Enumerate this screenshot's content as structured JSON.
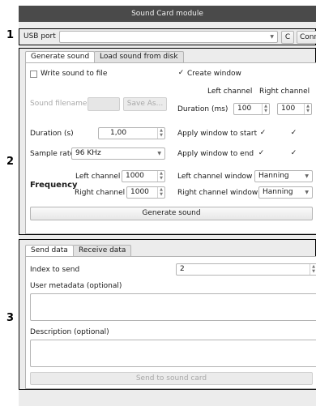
{
  "window": {
    "title": "Sound Card module"
  },
  "section_numbers": [
    "1",
    "2",
    "3"
  ],
  "usb": {
    "label": "USB port",
    "port_value": "",
    "refresh_label": "C",
    "connect_label": "Connect"
  },
  "generate": {
    "tabs": [
      {
        "label": "Generate sound",
        "active": true
      },
      {
        "label": "Load sound from disk",
        "active": false
      }
    ],
    "write_to_file": {
      "label": "Write sound to file",
      "checked": false
    },
    "create_window": {
      "label": "Create window",
      "checked": true
    },
    "sound_filename": {
      "label": "Sound filename",
      "value": ""
    },
    "save_as_label": "Save As...",
    "left_channel_header": "Left channel",
    "right_channel_header": "Right channel",
    "window_duration": {
      "label": "Duration (ms)",
      "left": "100",
      "right": "100"
    },
    "duration": {
      "label": "Duration (s)",
      "value": "1,00"
    },
    "apply_start": {
      "label": "Apply window to start",
      "left_checked": true,
      "right_checked": true
    },
    "sample_rate": {
      "label": "Sample rate",
      "value": "96 KHz"
    },
    "apply_end": {
      "label": "Apply window to end",
      "left_checked": true,
      "right_checked": true
    },
    "frequency": {
      "label": "Frequency",
      "left_label": "Left channel",
      "left_value": "1000",
      "right_label": "Right channel",
      "right_value": "1000"
    },
    "left_window": {
      "label": "Left channel window",
      "value": "Hanning"
    },
    "right_window": {
      "label": "Right channel window",
      "value": "Hanning"
    },
    "generate_button": "Generate sound"
  },
  "send": {
    "tabs": [
      {
        "label": "Send data",
        "active": true
      },
      {
        "label": "Receive data",
        "active": false
      }
    ],
    "index": {
      "label": "Index to send",
      "value": "2"
    },
    "metadata": {
      "label": "User metadata (optional)",
      "value": ""
    },
    "description": {
      "label": "Description (optional)",
      "value": ""
    },
    "send_button": "Send to sound card"
  }
}
